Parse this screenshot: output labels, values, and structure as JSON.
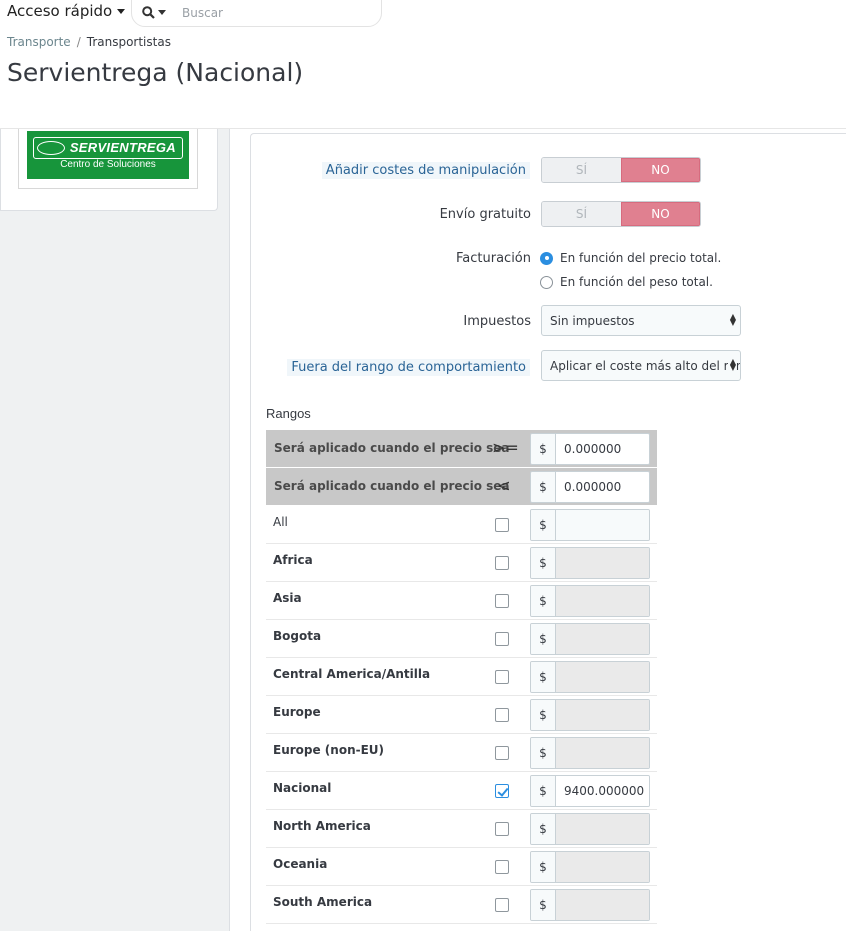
{
  "topbar": {
    "quick_access_label": "Acceso rápido",
    "search_placeholder": "Buscar"
  },
  "breadcrumb": {
    "parent": "Transporte",
    "separator": "/",
    "current": "Transportistas"
  },
  "page_title": "Servientrega (Nacional)",
  "logo": {
    "brand": "SERVIENTREGA",
    "tagline": "Centro de Soluciones",
    "color": "#17953b"
  },
  "form": {
    "handling": {
      "label": "Añadir costes de manipulación",
      "yes": "SÍ",
      "no": "NO",
      "selected": "NO"
    },
    "free_shipping": {
      "label": "Envío gratuito",
      "yes": "SÍ",
      "no": "NO",
      "selected": "NO"
    },
    "billing": {
      "label": "Facturación",
      "options": [
        "En función del precio total.",
        "En función del peso total."
      ],
      "selected_index": 0
    },
    "tax": {
      "label": "Impuestos",
      "value": "Sin impuestos"
    },
    "out_of_range": {
      "label": "Fuera del rango de comportamiento",
      "value": "Aplicar el coste más alto del ran"
    }
  },
  "ranges": {
    "title": "Rangos",
    "header_rows": [
      {
        "label": "Será aplicado cuando el precio sea",
        "operator": ">=",
        "currency": "$",
        "value": "0.000000"
      },
      {
        "label": "Será aplicado cuando el precio sea",
        "operator": "<",
        "currency": "$",
        "value": "0.000000"
      }
    ],
    "zones": [
      {
        "name": "All",
        "checked": false,
        "currency": "$",
        "value": ""
      },
      {
        "name": "Africa",
        "checked": false,
        "currency": "$",
        "value": ""
      },
      {
        "name": "Asia",
        "checked": false,
        "currency": "$",
        "value": ""
      },
      {
        "name": "Bogota",
        "checked": false,
        "currency": "$",
        "value": ""
      },
      {
        "name": "Central America/Antilla",
        "checked": false,
        "currency": "$",
        "value": ""
      },
      {
        "name": "Europe",
        "checked": false,
        "currency": "$",
        "value": ""
      },
      {
        "name": "Europe (non-EU)",
        "checked": false,
        "currency": "$",
        "value": ""
      },
      {
        "name": "Nacional",
        "checked": true,
        "currency": "$",
        "value": "9400.000000"
      },
      {
        "name": "North America",
        "checked": false,
        "currency": "$",
        "value": ""
      },
      {
        "name": "Oceania",
        "checked": false,
        "currency": "$",
        "value": ""
      },
      {
        "name": "South America",
        "checked": false,
        "currency": "$",
        "value": ""
      }
    ]
  },
  "colors": {
    "switch_no": "#e08090",
    "accent": "#2b8ee0"
  }
}
